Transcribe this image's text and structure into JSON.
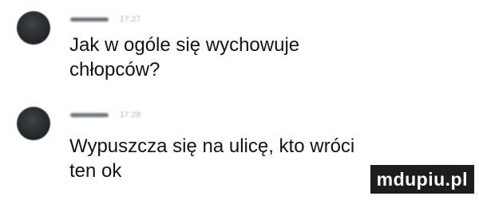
{
  "messages": [
    {
      "author": "",
      "time": "17:27",
      "text": "Jak w ogóle się wychowuje\nchłopców?"
    },
    {
      "author": "",
      "time": "17:28",
      "text": "Wypuszcza się na ulicę, kto wróci\nten ok"
    }
  ],
  "watermark": {
    "text": "mdupiu.pl"
  }
}
